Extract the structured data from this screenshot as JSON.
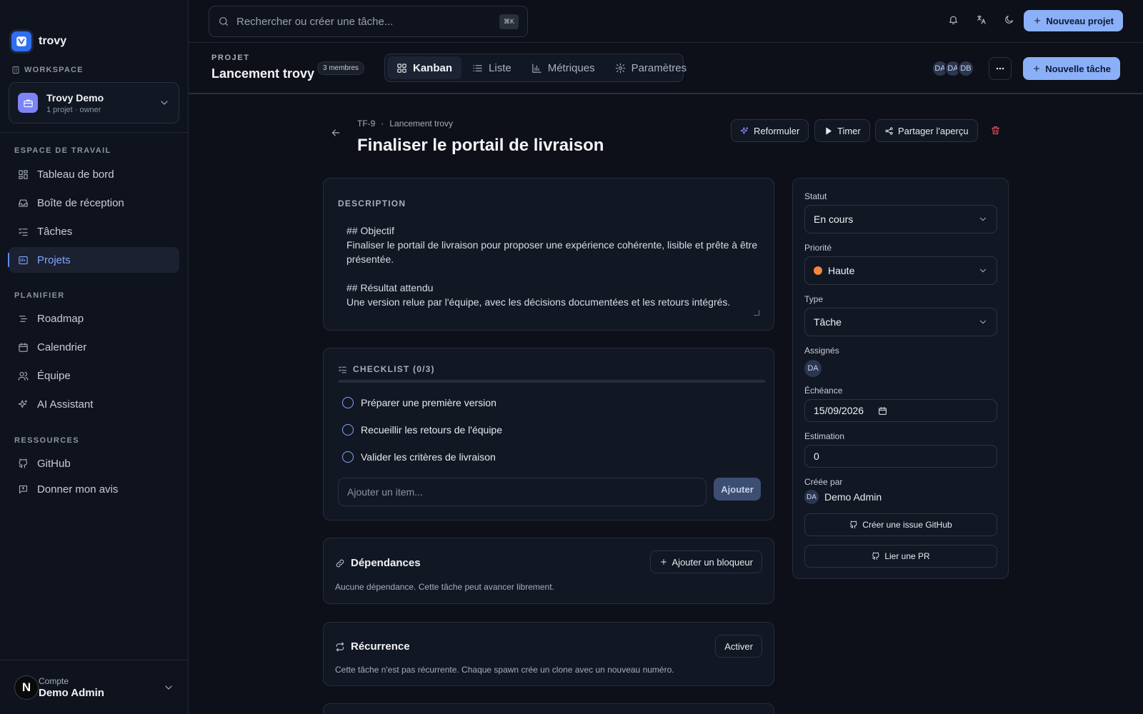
{
  "brand": {
    "name": "trovy",
    "logo_icon": "check-logo-icon"
  },
  "workspace": {
    "section_label": "WORKSPACE",
    "name": "Trovy Demo",
    "subtitle": "1 projet · owner",
    "avatar_color": "#7d84f6"
  },
  "sidebar": {
    "sections": [
      {
        "label": "ESPACE DE TRAVAIL",
        "items": [
          {
            "label": "Tableau de bord",
            "icon": "dashboard-icon",
            "active": false
          },
          {
            "label": "Boîte de réception",
            "icon": "inbox-icon",
            "active": false
          },
          {
            "label": "Tâches",
            "icon": "tasks-icon",
            "active": false
          },
          {
            "label": "Projets",
            "icon": "projects-icon",
            "active": true
          }
        ]
      },
      {
        "label": "PLANIFIER",
        "items": [
          {
            "label": "Roadmap",
            "icon": "roadmap-icon",
            "active": false
          },
          {
            "label": "Calendrier",
            "icon": "calendar-icon",
            "active": false
          },
          {
            "label": "Équipe",
            "icon": "team-icon",
            "active": false
          },
          {
            "label": "AI Assistant",
            "icon": "sparkles-icon",
            "active": false
          }
        ]
      },
      {
        "label": "RESSOURCES",
        "items": [
          {
            "label": "GitHub",
            "icon": "github-icon",
            "active": false
          },
          {
            "label": "Donner mon avis",
            "icon": "feedback-icon",
            "active": false
          }
        ]
      }
    ]
  },
  "account": {
    "label": "Compte",
    "name": "Demo Admin",
    "avatar": "N"
  },
  "topbar": {
    "search_placeholder": "Rechercher ou créer une tâche...",
    "search_shortcut": "⌘K",
    "new_project_label": "Nouveau projet"
  },
  "project": {
    "label": "PROJET",
    "title": "Lancement trovy",
    "members": "3 membres",
    "tabs": [
      {
        "label": "Kanban",
        "icon": "kanban-icon",
        "active": true
      },
      {
        "label": "Liste",
        "icon": "list-icon",
        "active": false
      },
      {
        "label": "Métriques",
        "icon": "chart-icon",
        "active": false
      },
      {
        "label": "Paramètres",
        "icon": "gear-icon",
        "active": false
      }
    ],
    "member_avatars": [
      "DA",
      "DA",
      "DB"
    ],
    "new_task_label": "Nouvelle tâche"
  },
  "task": {
    "id": "TF-9",
    "project": "Lancement trovy",
    "separator": "·",
    "title": "Finaliser le portail de livraison",
    "actions": {
      "rephrase": "Reformuler",
      "timer": "Timer",
      "share": "Partager l'aperçu"
    },
    "description_label": "DESCRIPTION",
    "description": "## Objectif\nFinaliser le portail de livraison pour proposer une expérience cohérente, lisible et prête à être présentée.\n\n## Résultat attendu\nUne version relue par l'équipe, avec les décisions documentées et les retours intégrés.",
    "checklist": {
      "label": "CHECKLIST (0/3)",
      "progress": 0,
      "items": [
        {
          "label": "Préparer une première version",
          "done": false
        },
        {
          "label": "Recueillir les retours de l'équipe",
          "done": false
        },
        {
          "label": "Valider les critères de livraison",
          "done": false
        }
      ],
      "add_placeholder": "Ajouter un item...",
      "add_button": "Ajouter"
    },
    "dependencies": {
      "title": "Dépendances",
      "note": "Aucune dépendance. Cette tâche peut avancer librement.",
      "button": "Ajouter un bloqueur"
    },
    "recurrence": {
      "title": "Récurrence",
      "note": "Cette tâche n'est pas récurrente. Chaque spawn crée un clone avec un nouveau numéro.",
      "button": "Activer"
    }
  },
  "details": {
    "status_label": "Statut",
    "status": "En cours",
    "priority_label": "Priorité",
    "priority": "Haute",
    "priority_color": "#f0873f",
    "type_label": "Type",
    "type": "Tâche",
    "assignees_label": "Assignés",
    "assignee": "DA",
    "due_label": "Échéance",
    "due": "15/09/2026",
    "estimate_label": "Estimation",
    "estimate": "0",
    "created_label": "Créée par",
    "creator_initials": "DA",
    "creator": "Demo Admin",
    "github_issue": "Créer une issue GitHub",
    "link_pr": "Lier une PR"
  },
  "colors": {
    "accent": "#8bb0f8",
    "active_nav": "#7fa7ff",
    "danger": "#e05260"
  }
}
